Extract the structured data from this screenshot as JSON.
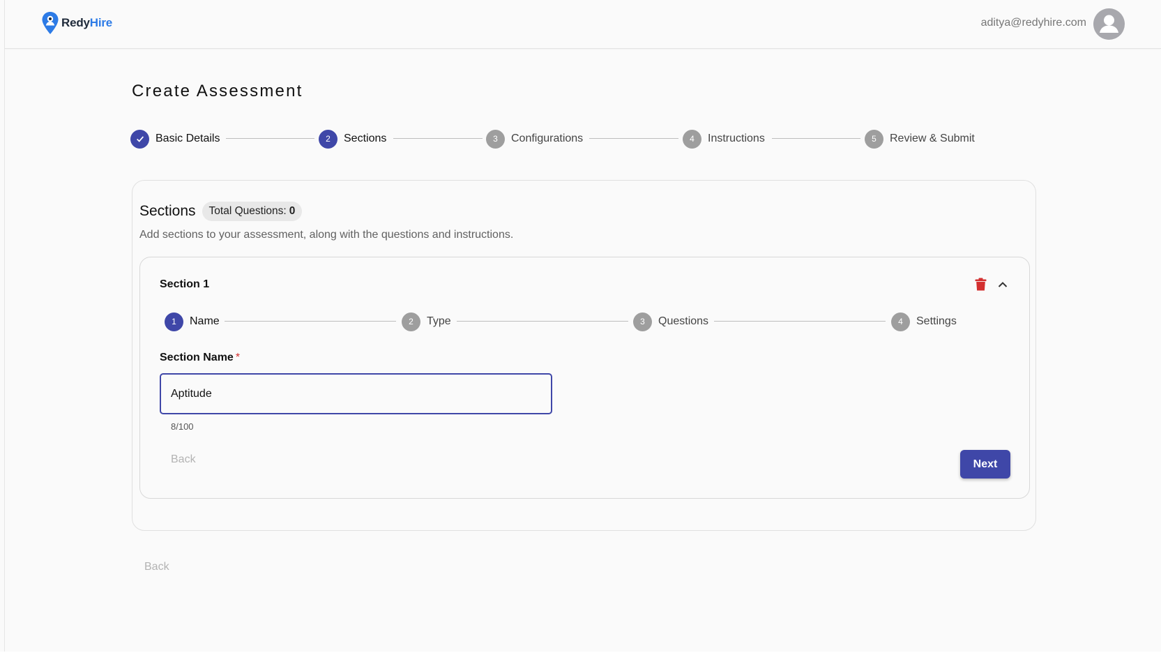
{
  "header": {
    "brand_part1": "Redy",
    "brand_part2": "Hire",
    "user_email": "aditya@redyhire.com"
  },
  "page": {
    "title": "Create Assessment"
  },
  "main_stepper": {
    "steps": [
      {
        "number": "✓",
        "label": "Basic Details",
        "state": "completed"
      },
      {
        "number": "2",
        "label": "Sections",
        "state": "active"
      },
      {
        "number": "3",
        "label": "Configurations",
        "state": "pending"
      },
      {
        "number": "4",
        "label": "Instructions",
        "state": "pending"
      },
      {
        "number": "5",
        "label": "Review & Submit",
        "state": "pending"
      }
    ]
  },
  "sections_card": {
    "title": "Sections",
    "total_questions_label": "Total Questions:",
    "total_questions_value": "0",
    "description": "Add sections to your assessment, along with the questions and instructions."
  },
  "section": {
    "title": "Section 1",
    "substeps": [
      {
        "number": "1",
        "label": "Name",
        "state": "active"
      },
      {
        "number": "2",
        "label": "Type",
        "state": "pending"
      },
      {
        "number": "3",
        "label": "Questions",
        "state": "pending"
      },
      {
        "number": "4",
        "label": "Settings",
        "state": "pending"
      }
    ],
    "field_label": "Section Name",
    "required_marker": "*",
    "field_value": "Aptitude",
    "char_count": "8/100",
    "back_label": "Back",
    "next_label": "Next"
  },
  "footer": {
    "back_label": "Back"
  },
  "colors": {
    "primary": "#3f47a8",
    "brand_blue": "#2d7be6",
    "pending": "#9e9e9e",
    "danger": "#d32f2f"
  }
}
